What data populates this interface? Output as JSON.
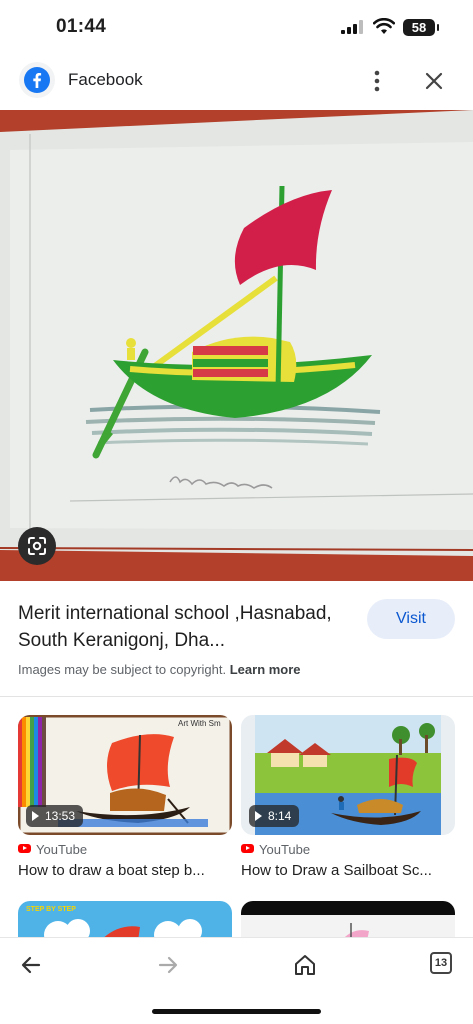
{
  "status_bar": {
    "time": "01:44",
    "battery": "58",
    "icons": [
      "signal-icon",
      "wifi-icon",
      "battery-icon"
    ]
  },
  "header": {
    "site_name": "Facebook",
    "site_icon": "facebook-icon",
    "more_icon": "more-vert-icon",
    "close_icon": "close-icon"
  },
  "main_image": {
    "lens_icon": "google-lens-icon"
  },
  "info": {
    "title": "Merit international school ,Hasnabad, South Keranigonj, Dha...",
    "visit_label": "Visit",
    "copyright_text": "Images may be subject to copyright.",
    "learn_more": "Learn more"
  },
  "related": [
    {
      "duration": "13:53",
      "source": "YouTube",
      "title": "How to draw a boat step b...",
      "thumb_text": "Art With Sm"
    },
    {
      "duration": "8:14",
      "source": "YouTube",
      "title": "How to Draw a Sailboat Sc...",
      "thumb_text": ""
    },
    {
      "thumb_text": "STEP BY STEP",
      "source": "",
      "title": ""
    },
    {
      "source": "",
      "title": ""
    }
  ],
  "toolbar": {
    "back_icon": "back-arrow-icon",
    "forward_icon": "forward-arrow-icon",
    "home_icon": "home-icon",
    "tabs_count": "13"
  },
  "colors": {
    "accent": "#0b57d0",
    "visit_bg": "#e8eef9",
    "youtube_red": "#ff0000"
  }
}
